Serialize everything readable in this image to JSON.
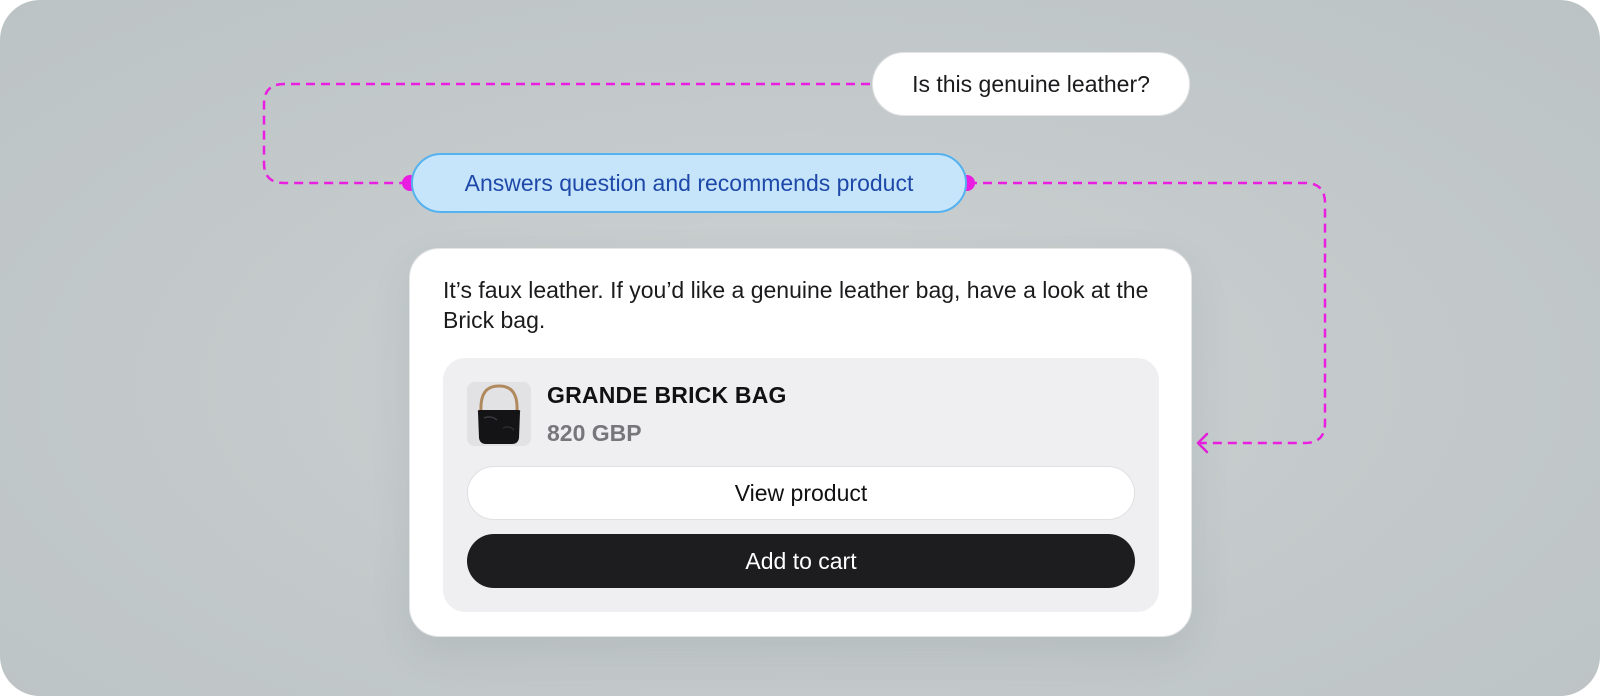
{
  "user_message": {
    "text": "Is this genuine leather?"
  },
  "flow_step": {
    "label": "Answers question and recommends product"
  },
  "assistant_reply": {
    "text": "It’s faux leather. If you’d like a genuine leather bag, have a look at the Brick bag.",
    "product": {
      "name": "GRANDE BRICK BAG",
      "price": "820 GBP",
      "image_icon": "black-leather-handbag",
      "view_label": "View product",
      "cart_label": "Add to cart"
    }
  },
  "colors": {
    "connector": "#e91ee0",
    "step_fill": "#c6e5fb",
    "step_border": "#55b2ef",
    "step_text": "#1e49a8",
    "cart_button": "#1d1d1f",
    "background": "#c3c9ca"
  }
}
